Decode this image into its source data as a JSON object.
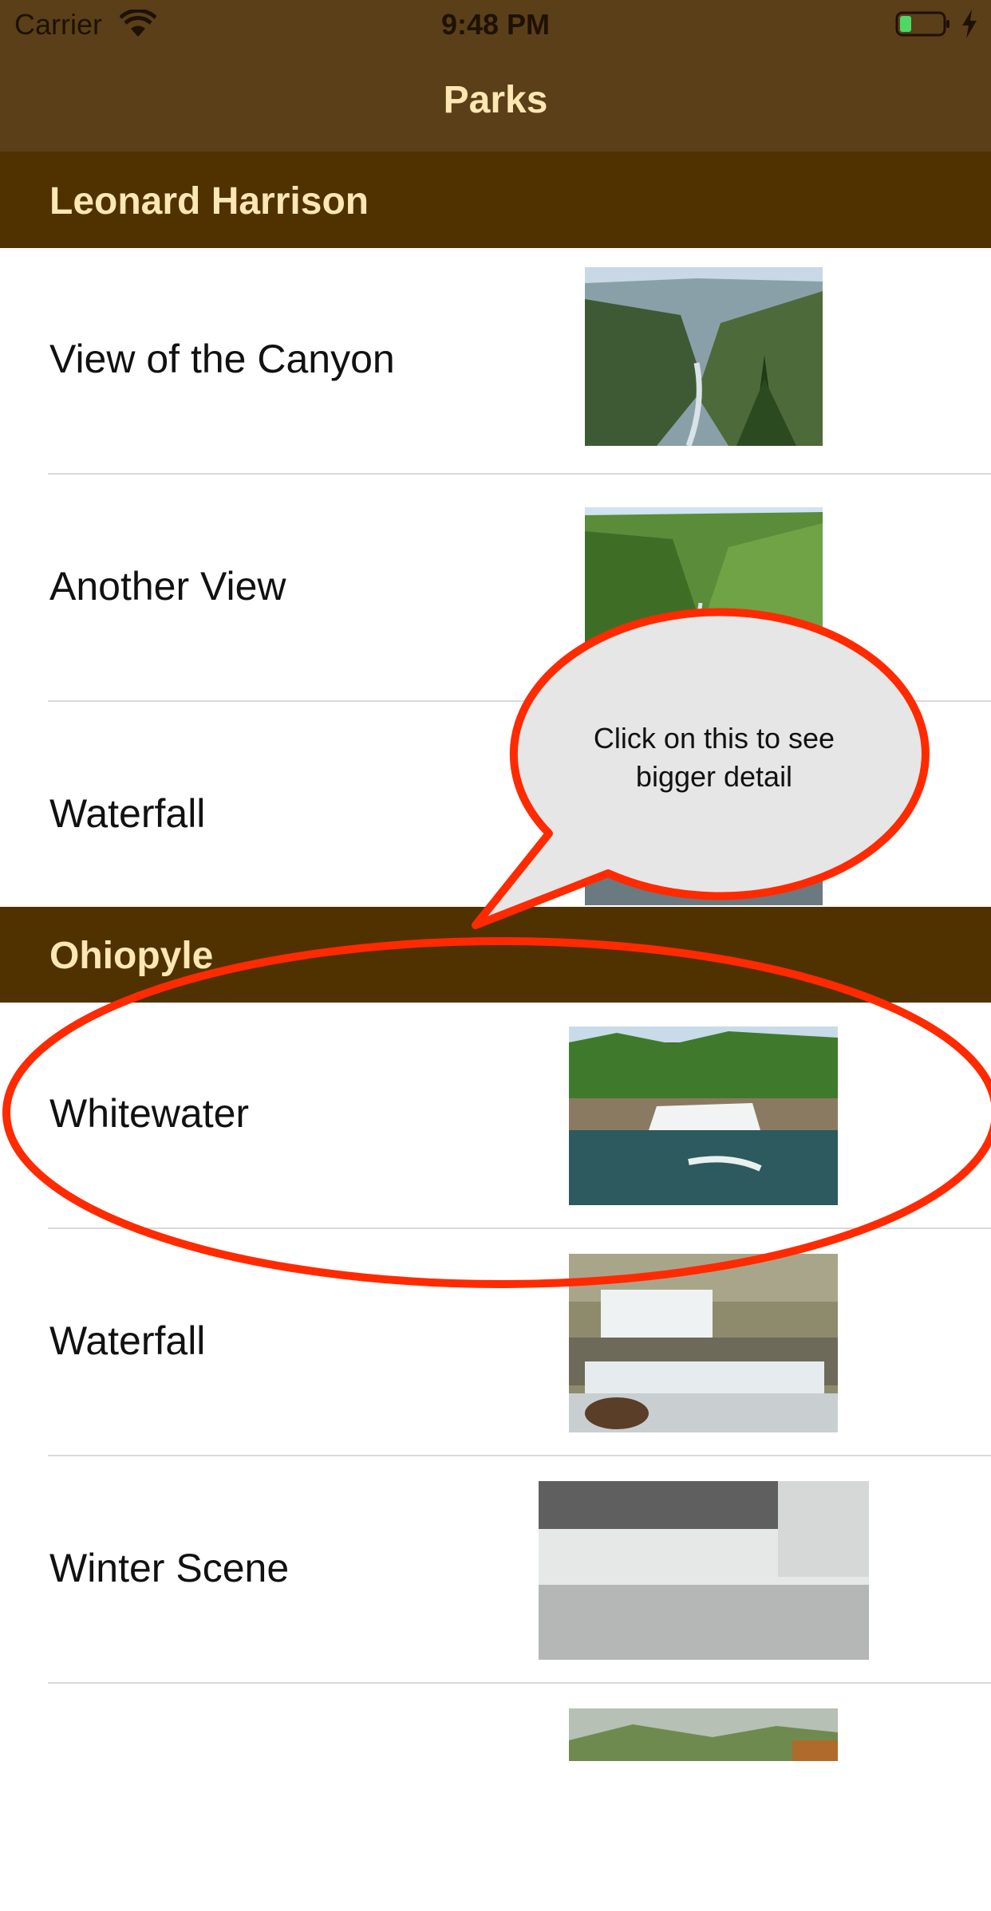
{
  "status_bar": {
    "carrier": "Carrier",
    "time": "9:48 PM"
  },
  "nav": {
    "title": "Parks"
  },
  "sections": [
    {
      "title": "Leonard Harrison",
      "rows": [
        {
          "label": "View of the Canyon",
          "image": "canyon-view-photo"
        },
        {
          "label": "Another View",
          "image": "green-canyon-photo"
        },
        {
          "label": "Waterfall",
          "image": "waterfall-photo"
        }
      ]
    },
    {
      "title": "Ohiopyle",
      "rows": [
        {
          "label": "Whitewater",
          "image": "whitewater-photo"
        },
        {
          "label": "Waterfall",
          "image": "cascade-photo"
        },
        {
          "label": "Winter Scene",
          "image": "winter-falls-photo"
        },
        {
          "label": "",
          "image": "foggy-forest-photo"
        }
      ]
    }
  ],
  "annotation": {
    "callout_text": "Click on this to see bigger detail",
    "color": "#ff2a00",
    "bubble_fill": "#e6e6e6"
  }
}
